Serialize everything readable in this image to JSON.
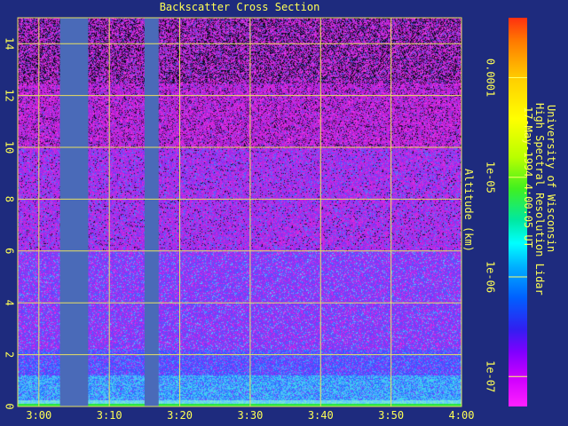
{
  "chart_data": {
    "type": "heatmap",
    "title": "Backscatter Cross Section",
    "ylabel": "Altitude (km)",
    "xlabel": "",
    "x_ticks": [
      "3:00",
      "3:10",
      "3:20",
      "3:30",
      "3:40",
      "3:50",
      "4:00"
    ],
    "y_ticks": [
      "0",
      "2",
      "4",
      "6",
      "8",
      "10",
      "12",
      "14"
    ],
    "xlim_minutes_after_0300": [
      -3,
      60
    ],
    "ylim": [
      0,
      15
    ],
    "grid": true,
    "data_gaps": [
      {
        "start": "3:03",
        "end": "3:07"
      },
      {
        "start": "3:15",
        "end": "3:17"
      }
    ],
    "colorbar": {
      "scale": "log",
      "tick_labels": [
        "0.0001",
        "1e-05",
        "1e-06",
        "1e-07"
      ],
      "range": [
        5e-08,
        0.0004
      ],
      "placement": "right"
    },
    "colors": {
      "background": "#1e2b7e",
      "text": "#ffff55",
      "grid": "#e8e060",
      "gap": "#4a6ab8"
    }
  },
  "info": {
    "line1": "University of Wisconsin",
    "line2": "High Spectral Resolution Lidar",
    "line3": "17-May-1994  4:00:05 UT"
  }
}
